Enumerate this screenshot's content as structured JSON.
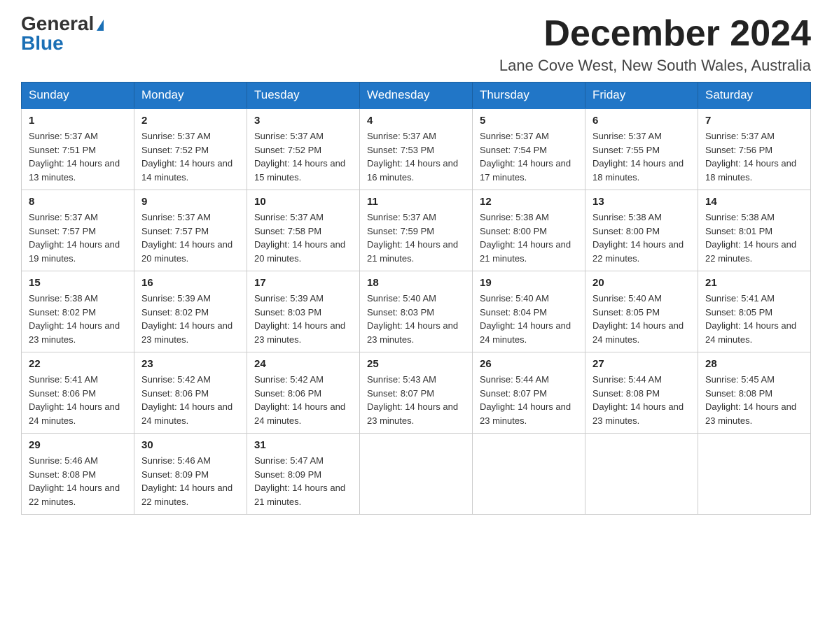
{
  "logo": {
    "general": "General",
    "blue": "Blue"
  },
  "title": "December 2024",
  "location": "Lane Cove West, New South Wales, Australia",
  "days_of_week": [
    "Sunday",
    "Monday",
    "Tuesday",
    "Wednesday",
    "Thursday",
    "Friday",
    "Saturday"
  ],
  "weeks": [
    [
      {
        "day": "1",
        "sunrise": "5:37 AM",
        "sunset": "7:51 PM",
        "daylight": "14 hours and 13 minutes."
      },
      {
        "day": "2",
        "sunrise": "5:37 AM",
        "sunset": "7:52 PM",
        "daylight": "14 hours and 14 minutes."
      },
      {
        "day": "3",
        "sunrise": "5:37 AM",
        "sunset": "7:52 PM",
        "daylight": "14 hours and 15 minutes."
      },
      {
        "day": "4",
        "sunrise": "5:37 AM",
        "sunset": "7:53 PM",
        "daylight": "14 hours and 16 minutes."
      },
      {
        "day": "5",
        "sunrise": "5:37 AM",
        "sunset": "7:54 PM",
        "daylight": "14 hours and 17 minutes."
      },
      {
        "day": "6",
        "sunrise": "5:37 AM",
        "sunset": "7:55 PM",
        "daylight": "14 hours and 18 minutes."
      },
      {
        "day": "7",
        "sunrise": "5:37 AM",
        "sunset": "7:56 PM",
        "daylight": "14 hours and 18 minutes."
      }
    ],
    [
      {
        "day": "8",
        "sunrise": "5:37 AM",
        "sunset": "7:57 PM",
        "daylight": "14 hours and 19 minutes."
      },
      {
        "day": "9",
        "sunrise": "5:37 AM",
        "sunset": "7:57 PM",
        "daylight": "14 hours and 20 minutes."
      },
      {
        "day": "10",
        "sunrise": "5:37 AM",
        "sunset": "7:58 PM",
        "daylight": "14 hours and 20 minutes."
      },
      {
        "day": "11",
        "sunrise": "5:37 AM",
        "sunset": "7:59 PM",
        "daylight": "14 hours and 21 minutes."
      },
      {
        "day": "12",
        "sunrise": "5:38 AM",
        "sunset": "8:00 PM",
        "daylight": "14 hours and 21 minutes."
      },
      {
        "day": "13",
        "sunrise": "5:38 AM",
        "sunset": "8:00 PM",
        "daylight": "14 hours and 22 minutes."
      },
      {
        "day": "14",
        "sunrise": "5:38 AM",
        "sunset": "8:01 PM",
        "daylight": "14 hours and 22 minutes."
      }
    ],
    [
      {
        "day": "15",
        "sunrise": "5:38 AM",
        "sunset": "8:02 PM",
        "daylight": "14 hours and 23 minutes."
      },
      {
        "day": "16",
        "sunrise": "5:39 AM",
        "sunset": "8:02 PM",
        "daylight": "14 hours and 23 minutes."
      },
      {
        "day": "17",
        "sunrise": "5:39 AM",
        "sunset": "8:03 PM",
        "daylight": "14 hours and 23 minutes."
      },
      {
        "day": "18",
        "sunrise": "5:40 AM",
        "sunset": "8:03 PM",
        "daylight": "14 hours and 23 minutes."
      },
      {
        "day": "19",
        "sunrise": "5:40 AM",
        "sunset": "8:04 PM",
        "daylight": "14 hours and 24 minutes."
      },
      {
        "day": "20",
        "sunrise": "5:40 AM",
        "sunset": "8:05 PM",
        "daylight": "14 hours and 24 minutes."
      },
      {
        "day": "21",
        "sunrise": "5:41 AM",
        "sunset": "8:05 PM",
        "daylight": "14 hours and 24 minutes."
      }
    ],
    [
      {
        "day": "22",
        "sunrise": "5:41 AM",
        "sunset": "8:06 PM",
        "daylight": "14 hours and 24 minutes."
      },
      {
        "day": "23",
        "sunrise": "5:42 AM",
        "sunset": "8:06 PM",
        "daylight": "14 hours and 24 minutes."
      },
      {
        "day": "24",
        "sunrise": "5:42 AM",
        "sunset": "8:06 PM",
        "daylight": "14 hours and 24 minutes."
      },
      {
        "day": "25",
        "sunrise": "5:43 AM",
        "sunset": "8:07 PM",
        "daylight": "14 hours and 23 minutes."
      },
      {
        "day": "26",
        "sunrise": "5:44 AM",
        "sunset": "8:07 PM",
        "daylight": "14 hours and 23 minutes."
      },
      {
        "day": "27",
        "sunrise": "5:44 AM",
        "sunset": "8:08 PM",
        "daylight": "14 hours and 23 minutes."
      },
      {
        "day": "28",
        "sunrise": "5:45 AM",
        "sunset": "8:08 PM",
        "daylight": "14 hours and 23 minutes."
      }
    ],
    [
      {
        "day": "29",
        "sunrise": "5:46 AM",
        "sunset": "8:08 PM",
        "daylight": "14 hours and 22 minutes."
      },
      {
        "day": "30",
        "sunrise": "5:46 AM",
        "sunset": "8:09 PM",
        "daylight": "14 hours and 22 minutes."
      },
      {
        "day": "31",
        "sunrise": "5:47 AM",
        "sunset": "8:09 PM",
        "daylight": "14 hours and 21 minutes."
      },
      null,
      null,
      null,
      null
    ]
  ]
}
